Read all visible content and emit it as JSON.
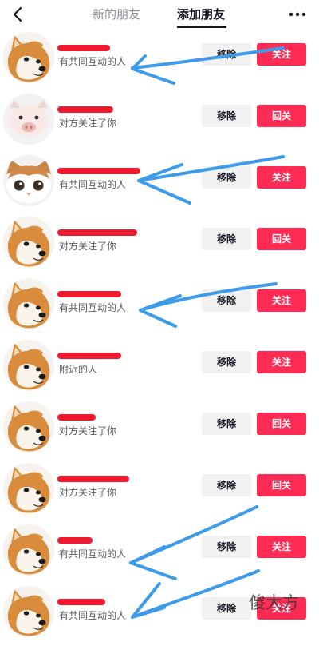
{
  "header": {
    "tabs": [
      {
        "label": "新的朋友",
        "active": false
      },
      {
        "label": "添加朋友",
        "active": true
      }
    ]
  },
  "buttons": {
    "remove_label": "移除"
  },
  "colors": {
    "accent": "#fe2c55",
    "remove_bg": "#f1f1f2",
    "redaction": "#f01a30",
    "annotation_arrow": "#3d9be9"
  },
  "rows": [
    {
      "subtitle": "有共同互动的人",
      "action_label": "关注",
      "avatar": "shiba-dog-avatar"
    },
    {
      "subtitle": "对方关注了你",
      "action_label": "回关",
      "avatar": "piglet-avatar"
    },
    {
      "subtitle": "有共同互动的人",
      "action_label": "关注",
      "avatar": "exotic-cat-avatar"
    },
    {
      "subtitle": "对方关注了你",
      "action_label": "回关",
      "avatar": "shiba-dog-avatar"
    },
    {
      "subtitle": "有共同互动的人",
      "action_label": "关注",
      "avatar": "shiba-dog-avatar"
    },
    {
      "subtitle": "附近的人",
      "action_label": "关注",
      "avatar": "shiba-dog-avatar"
    },
    {
      "subtitle": "对方关注了你",
      "action_label": "回关",
      "avatar": "shiba-dog-avatar"
    },
    {
      "subtitle": "对方关注了你",
      "action_label": "回关",
      "avatar": "shiba-dog-avatar"
    },
    {
      "subtitle": "有共同互动的人",
      "action_label": "关注",
      "avatar": "shiba-dog-avatar"
    },
    {
      "subtitle": "有共同互动的人",
      "action_label": "关注",
      "avatar": "shiba-dog-avatar"
    }
  ],
  "watermark": "傻大方"
}
